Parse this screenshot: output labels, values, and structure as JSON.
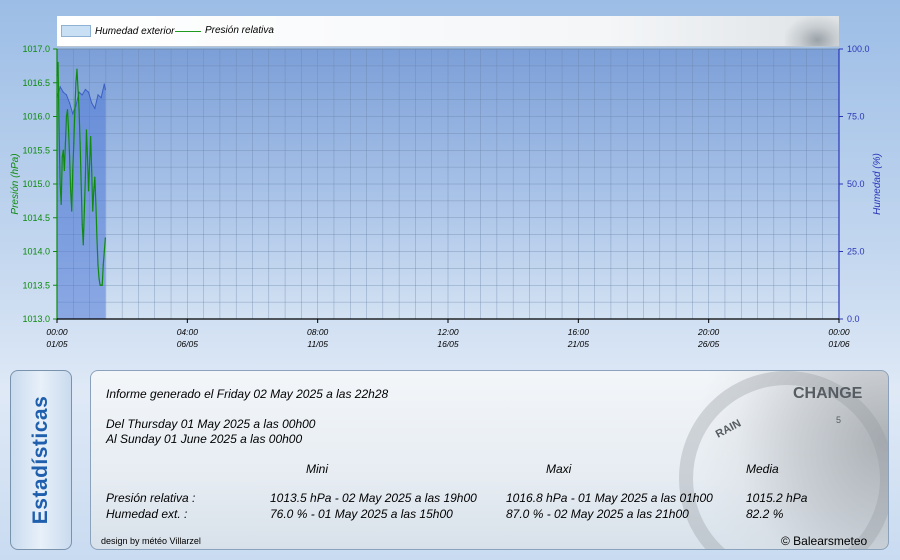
{
  "legend": {
    "area_label": "Humedad exterior",
    "line_label": "Presión relativa"
  },
  "chart_data": {
    "type": "line",
    "xlim": [
      "2025-05-01 00:00",
      "2025-06-01 00:00"
    ],
    "x_tick_labels": [
      [
        "00:00",
        "01/05"
      ],
      [
        "04:00",
        "06/05"
      ],
      [
        "08:00",
        "11/05"
      ],
      [
        "12:00",
        "16/05"
      ],
      [
        "16:00",
        "21/05"
      ],
      [
        "20:00",
        "26/05"
      ],
      [
        "00:00",
        "01/06"
      ]
    ],
    "y_left": {
      "label": "Presión (hPa)",
      "lim": [
        1013.0,
        1017.0
      ],
      "tick_labels": [
        "1013.0",
        "1013.5",
        "1014.0",
        "1014.5",
        "1015.0",
        "1015.5",
        "1016.0",
        "1016.5",
        "1017.0"
      ]
    },
    "y_right": {
      "label": "Humedad (%)",
      "lim": [
        0,
        100
      ],
      "tick_labels": [
        "0.0",
        "25.0",
        "50.0",
        "75.0",
        "100.0"
      ]
    },
    "grid": true,
    "legend_position": "top",
    "colors": {
      "pressure": "#118a11",
      "humidity": "#4f79d6",
      "left_axis": "#0d8a0d",
      "right_axis": "#2a36b8"
    },
    "series": [
      {
        "name": "Humedad exterior",
        "type": "area",
        "axis": "right",
        "x": [
          "2025-05-01 00:00",
          "2025-05-01 03:00",
          "2025-05-01 06:00",
          "2025-05-01 09:00",
          "2025-05-01 12:00",
          "2025-05-01 15:00",
          "2025-05-01 18:00",
          "2025-05-01 21:00",
          "2025-05-02 00:00",
          "2025-05-02 03:00",
          "2025-05-02 06:00",
          "2025-05-02 09:00",
          "2025-05-02 12:00",
          "2025-05-02 15:00",
          "2025-05-02 18:00",
          "2025-05-02 21:00",
          "2025-05-02 22:00"
        ],
        "values": [
          82,
          86,
          84,
          83,
          80,
          76,
          79,
          84,
          83,
          85,
          84,
          80,
          78,
          83,
          82,
          87,
          85
        ]
      },
      {
        "name": "Presión relativa",
        "type": "line",
        "axis": "left",
        "x": [
          "2025-05-01 00:00",
          "2025-05-01 01:00",
          "2025-05-01 02:00",
          "2025-05-01 03:00",
          "2025-05-01 04:00",
          "2025-05-01 05:00",
          "2025-05-01 06:00",
          "2025-05-01 07:00",
          "2025-05-01 08:00",
          "2025-05-01 09:00",
          "2025-05-01 10:00",
          "2025-05-01 11:00",
          "2025-05-01 12:00",
          "2025-05-01 13:00",
          "2025-05-01 14:00",
          "2025-05-01 15:00",
          "2025-05-01 16:00",
          "2025-05-01 17:00",
          "2025-05-01 18:00",
          "2025-05-01 19:00",
          "2025-05-01 20:00",
          "2025-05-01 21:00",
          "2025-05-01 22:00",
          "2025-05-01 23:00",
          "2025-05-02 00:00",
          "2025-05-02 01:00",
          "2025-05-02 02:00",
          "2025-05-02 03:00",
          "2025-05-02 04:00",
          "2025-05-02 05:00",
          "2025-05-02 06:00",
          "2025-05-02 07:00",
          "2025-05-02 08:00",
          "2025-05-02 09:00",
          "2025-05-02 10:00",
          "2025-05-02 11:00",
          "2025-05-02 12:00",
          "2025-05-02 13:00",
          "2025-05-02 14:00",
          "2025-05-02 15:00",
          "2025-05-02 16:00",
          "2025-05-02 17:00",
          "2025-05-02 18:00",
          "2025-05-02 19:00",
          "2025-05-02 20:00",
          "2025-05-02 21:00",
          "2025-05-02 22:00"
        ],
        "values": [
          1016.6,
          1016.8,
          1015.8,
          1015.0,
          1014.7,
          1015.4,
          1015.5,
          1015.2,
          1015.6,
          1016.0,
          1016.1,
          1015.8,
          1015.4,
          1014.9,
          1014.6,
          1015.2,
          1015.6,
          1016.1,
          1016.5,
          1016.7,
          1016.4,
          1016.1,
          1015.6,
          1015.0,
          1014.4,
          1014.1,
          1014.6,
          1015.1,
          1015.8,
          1015.4,
          1014.9,
          1015.3,
          1015.7,
          1015.2,
          1014.6,
          1014.9,
          1015.1,
          1014.7,
          1014.2,
          1013.8,
          1013.6,
          1013.5,
          1013.5,
          1013.5,
          1013.8,
          1014.0,
          1014.2
        ]
      }
    ]
  },
  "stats": {
    "tab_label": "Estadísticas",
    "generated": "Informe generado el Friday 02 May 2025 a las 22h28",
    "from": "Del Thursday 01 May 2025 a las 00h00",
    "to": "Al Sunday 01 June 2025 a las 00h00",
    "columns": {
      "min": "Mini",
      "max": "Maxi",
      "avg": "Media"
    },
    "rows": [
      {
        "label": "Presión relativa :",
        "min": "1013.5 hPa - 02 May 2025 a las 19h00",
        "max": "1016.8 hPa - 01 May 2025 a las 01h00",
        "avg": "1015.2 hPa"
      },
      {
        "label": "Humedad ext. :",
        "min": "76.0 % - 01 May 2025 a las 15h00",
        "max": "87.0 % - 02 May 2025 a las 21h00",
        "avg": "82.2 %"
      }
    ],
    "design_credit": "design by météo Villarzel",
    "copyright": "© Balearsmeteo"
  },
  "barometer": {
    "change": "CHANGE",
    "rain": "RAIN",
    "number": "5"
  }
}
